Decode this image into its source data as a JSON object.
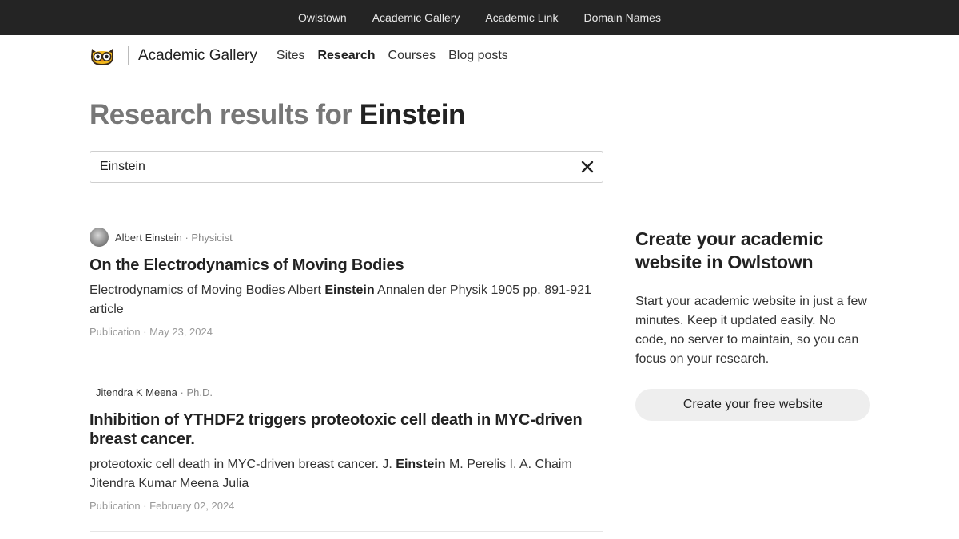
{
  "topbar": {
    "links": [
      "Owlstown",
      "Academic Gallery",
      "Academic Link",
      "Domain Names"
    ]
  },
  "navbar": {
    "logo_icon": "owl-logo-icon",
    "brand": "Academic Gallery",
    "links": [
      "Sites",
      "Research",
      "Courses",
      "Blog posts"
    ],
    "active": "Research"
  },
  "hero": {
    "heading_prefix": "Research results for",
    "query": "Einstein"
  },
  "search": {
    "value": "Einstein",
    "clear_icon": "close-icon"
  },
  "results": [
    {
      "author": "Albert Einstein",
      "role": "· Physicist",
      "has_avatar": true,
      "title": "On the Electrodynamics of Moving Bodies",
      "snippet_before": "Electrodynamics of Moving Bodies Albert ",
      "snippet_highlight": "Einstein",
      "snippet_after": " Annalen der Physik 1905 pp. 891-921 article",
      "type": "Publication",
      "date": "· May 23, 2024"
    },
    {
      "author": "Jitendra K Meena",
      "role": "· Ph.D.",
      "has_avatar": false,
      "title": "Inhibition of YTHDF2 triggers proteotoxic cell death in MYC-driven breast cancer.",
      "snippet_before": "proteotoxic cell death in MYC-driven breast cancer. J. ",
      "snippet_highlight": "Einstein",
      "snippet_after": " M. Perelis I. A. Chaim Jitendra Kumar Meena Julia",
      "type": "Publication",
      "date": "· February 02, 2024"
    }
  ],
  "sidebar": {
    "heading": "Create your academic website in Owlstown",
    "body": "Start your academic website in just a few minutes. Keep it updated easily. No code, no server to maintain, so you can focus on your research.",
    "cta": "Create your free website"
  }
}
